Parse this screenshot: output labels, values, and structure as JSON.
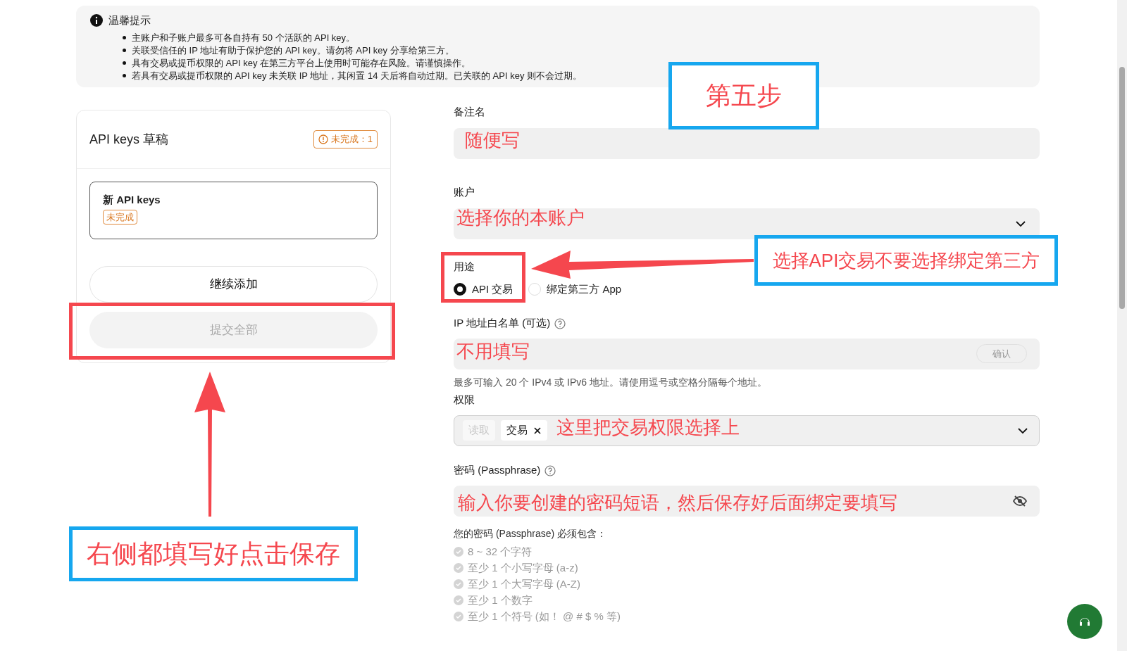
{
  "notice": {
    "title": "温馨提示",
    "items": [
      "主账户和子账户最多可各自持有 50 个活跃的 API key。",
      "关联受信任的 IP 地址有助于保护您的 API key。请勿将 API key 分享给第三方。",
      "具有交易或提币权限的 API key 在第三方平台上使用时可能存在风险。请谨慎操作。",
      "若具有交易或提币权限的 API key 未关联 IP 地址，其闲置 14 天后将自动过期。已关联的 API key 则不会过期。"
    ]
  },
  "drafts": {
    "title": "API keys 草稿",
    "incomplete_badge": "未完成：1",
    "items": [
      {
        "name": "新 API keys",
        "status": "未完成",
        "selected": true
      }
    ],
    "continue_button": "继续添加",
    "submit_button": {
      "label": "提交全部",
      "disabled": true
    }
  },
  "form": {
    "remark": {
      "label": "备注名"
    },
    "account": {
      "label": "账户"
    },
    "usage": {
      "label": "用途",
      "options": [
        {
          "label": "API 交易",
          "selected": true
        },
        {
          "label": "绑定第三方 App",
          "selected": false
        }
      ]
    },
    "ip_whitelist": {
      "label": "IP 地址白名单 (可选)",
      "confirm_button": "确认",
      "hint": "最多可输入 20 个 IPv4 或 IPv6 地址。请使用逗号或空格分隔每个地址。"
    },
    "permissions": {
      "label": "权限",
      "tags": [
        {
          "label": "读取",
          "disabled": true,
          "removable": false
        },
        {
          "label": "交易",
          "disabled": false,
          "removable": true
        }
      ]
    },
    "passphrase": {
      "label": "密码 (Passphrase)",
      "requirements_title": "您的密码 (Passphrase) 必须包含：",
      "requirements": [
        {
          "text": "8 ~ 32 个字符",
          "met": false
        },
        {
          "text": "至少 1 个小写字母 (a-z)",
          "met": false
        },
        {
          "text": "至少 1 个大写字母 (A-Z)",
          "met": false
        },
        {
          "text": "至少 1 个数字",
          "met": false
        },
        {
          "text": "至少 1 个符号 (如！ @ # $ % 等)",
          "met": false
        }
      ]
    }
  },
  "annotations": [
    {
      "kind": "box",
      "text": "第五步"
    },
    {
      "kind": "text",
      "text": "随便写"
    },
    {
      "kind": "text",
      "text": "选择你的本账户"
    },
    {
      "kind": "frame"
    },
    {
      "kind": "arrow"
    },
    {
      "kind": "box",
      "text": "选择API交易不要选择绑定第三方"
    },
    {
      "kind": "text",
      "text": "不用填写"
    },
    {
      "kind": "text",
      "text": "这里把交易权限选择上"
    },
    {
      "kind": "text",
      "text": "输入你要创建的密码短语，然后保存好后面绑定要填写"
    },
    {
      "kind": "frame"
    },
    {
      "kind": "arrow"
    },
    {
      "kind": "box",
      "text": "右侧都填写好点击保存"
    }
  ]
}
